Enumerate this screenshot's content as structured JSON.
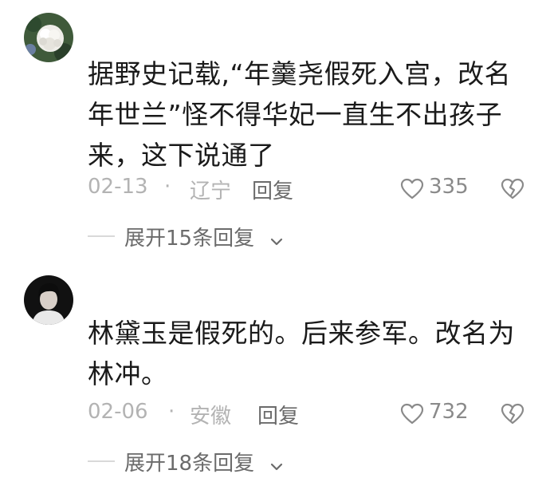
{
  "comments": [
    {
      "avatar": "flower-avatar",
      "text_lines": [
        "据野史记载,“年羹尧假死入宫，改名",
        "年世兰”怪不得华妃一直生不出孩子",
        "来，这下说通了"
      ],
      "date": "02-13",
      "separator": "·",
      "location": "辽宁",
      "reply_label": "回复",
      "likes": "335",
      "expand_label": "展开15条回复"
    },
    {
      "avatar": "person-avatar",
      "text_lines": [
        "林黛玉是假死的。后来参军。改名为",
        "林冲。"
      ],
      "date": "02-06",
      "separator": "·",
      "location": "安徽",
      "reply_label": "回复",
      "likes": "732",
      "expand_label": "展开18条回复"
    }
  ],
  "icons": {
    "like": "heart-outline-icon",
    "dislike": "broken-heart-icon",
    "expand": "chevron-down-icon"
  },
  "colors": {
    "text": "#1a1a1a",
    "meta": "#b3b3b3",
    "action": "#6b6b6b"
  }
}
